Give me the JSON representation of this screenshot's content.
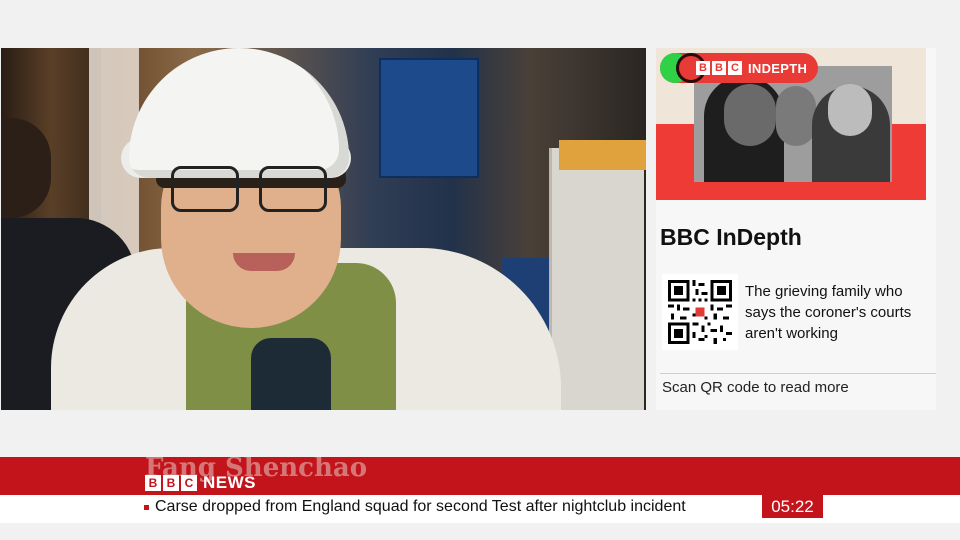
{
  "promo": {
    "logo_letters": [
      "B",
      "B",
      "C"
    ],
    "label": "INDEPTH"
  },
  "panel": {
    "title": "BBC InDepth",
    "story": "The grieving family who says the coroner's courts aren't working",
    "scan_text": "Scan QR code to read more"
  },
  "name_strip": {
    "ghost_text": "Fang Shenchao"
  },
  "brand": {
    "logo_letters": [
      "B",
      "B",
      "C"
    ],
    "word": "NEWS"
  },
  "ticker": {
    "headline": "Carse dropped from England squad for second Test after nightclub incident"
  },
  "clock": "05:22",
  "colors": {
    "bbc_red": "#c3141c",
    "indepth_red": "#ef3b36",
    "indepth_green": "#2fd247"
  }
}
